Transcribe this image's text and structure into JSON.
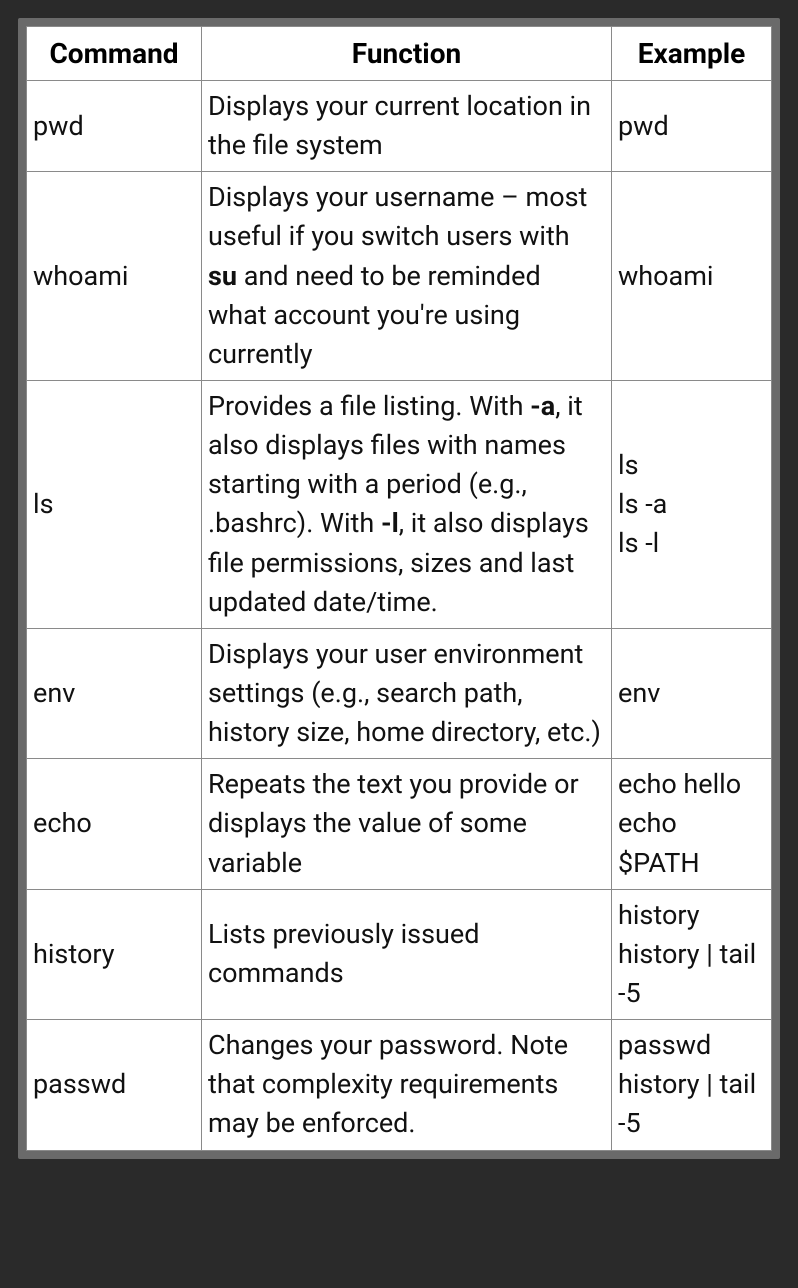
{
  "chart_data": {
    "type": "table",
    "headers": [
      "Command",
      "Function",
      "Example"
    ],
    "rows": [
      {
        "command": "pwd",
        "function_segments": [
          {
            "text": "Displays your current location in the file system",
            "bold": false
          }
        ],
        "example_lines": [
          "pwd"
        ]
      },
      {
        "command": "whoami",
        "function_segments": [
          {
            "text": "Displays your username – most useful if you switch users with ",
            "bold": false
          },
          {
            "text": "su",
            "bold": true
          },
          {
            "text": " and need to be reminded what account you're using currently",
            "bold": false
          }
        ],
        "example_lines": [
          "whoami"
        ]
      },
      {
        "command": "ls",
        "function_segments": [
          {
            "text": "Provides a file listing. With ",
            "bold": false
          },
          {
            "text": "-a",
            "bold": true
          },
          {
            "text": ", it also displays files with names starting with a period (e.g., .bashrc). With ",
            "bold": false
          },
          {
            "text": "-l",
            "bold": true
          },
          {
            "text": ", it also displays file permissions, sizes and last updated date/time.",
            "bold": false
          }
        ],
        "example_lines": [
          "ls",
          "ls -a",
          "ls -l"
        ]
      },
      {
        "command": "env",
        "function_segments": [
          {
            "text": "Displays your user environment settings (e.g., search path, history size, home directory, etc.)",
            "bold": false
          }
        ],
        "example_lines": [
          "env"
        ]
      },
      {
        "command": "echo",
        "function_segments": [
          {
            "text": "Repeats the text you provide or displays the value of some variable",
            "bold": false
          }
        ],
        "example_lines": [
          "echo hello",
          "echo $PATH"
        ]
      },
      {
        "command": "history",
        "function_segments": [
          {
            "text": "Lists previously issued commands",
            "bold": false
          }
        ],
        "example_lines": [
          "history",
          "history | tail -5"
        ]
      },
      {
        "command": "passwd",
        "function_segments": [
          {
            "text": "Changes your password. Note that complexity requirements may be enforced.",
            "bold": false
          }
        ],
        "example_lines": [
          "passwd",
          "history | tail -5"
        ]
      }
    ]
  }
}
